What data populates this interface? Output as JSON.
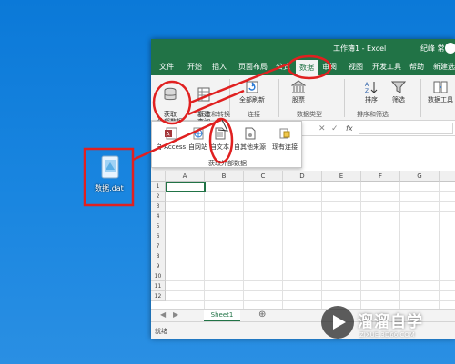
{
  "desktop": {
    "file_label": "数据.dat"
  },
  "window": {
    "title": "工作簿1 - Excel",
    "user": "纪峰 常",
    "tabs": [
      "文件",
      "开始",
      "插入",
      "页面布局",
      "公式",
      "数据",
      "审阅",
      "视图",
      "开发工具",
      "帮助",
      "新建选项卡"
    ],
    "active_tab": "数据"
  },
  "ribbon": {
    "get_external_data": "获取\n外部数据",
    "new_query": "新建\n查询",
    "refresh_all": "全部刷新",
    "stocks": "股票",
    "sort": "排序",
    "filter": "筛选",
    "data_tools": "数据工具",
    "groups": {
      "get_transform": "获取和转换",
      "connections": "连接",
      "data_types": "数据类型",
      "sort_filter": "排序和筛选"
    }
  },
  "dropdown": {
    "items": [
      "自 Access",
      "自网站",
      "自文本",
      "自其他来源",
      "现有连接"
    ],
    "group_label": "获取外部数据"
  },
  "formula_bar": {
    "fx": "fx"
  },
  "sheet": {
    "columns": [
      "A",
      "B",
      "C",
      "D",
      "E",
      "F",
      "G",
      "H"
    ],
    "rows": [
      "1",
      "2",
      "3",
      "4",
      "5",
      "6",
      "7",
      "8",
      "9",
      "10",
      "11",
      "12"
    ],
    "tab": "Sheet1",
    "add_sheet": "⊕"
  },
  "status": {
    "ready": "就绪"
  },
  "watermark": {
    "brand": "溜溜自学",
    "url": "ZIXUE.3D66.COM"
  },
  "colors": {
    "excel_green": "#217346",
    "annotation_red": "#e02020",
    "desktop_blue": "#0b79d8"
  }
}
